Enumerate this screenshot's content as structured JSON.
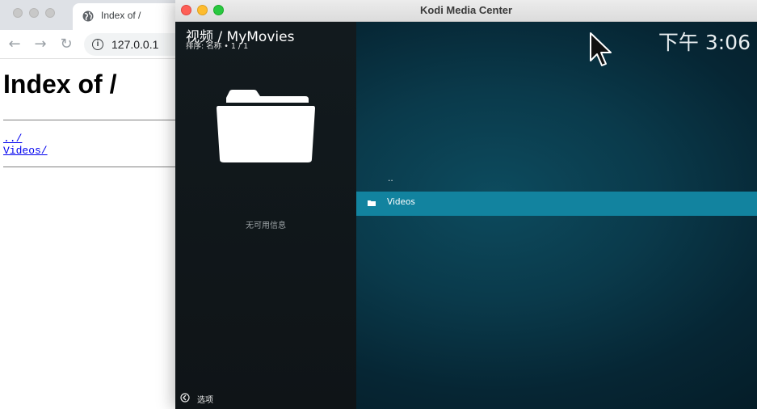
{
  "browser": {
    "tab_title": "Index of /",
    "url": "127.0.0.1",
    "page_heading": "Index of /",
    "links": [
      "../",
      "Videos/"
    ],
    "icons": {
      "back": "back-arrow-icon",
      "forward": "forward-arrow-icon",
      "reload": "reload-icon",
      "site_info": "info-icon",
      "favicon": "globe-icon"
    }
  },
  "kodi": {
    "window_title": "Kodi Media Center",
    "header_title": "视频 / MyMovies",
    "sort_info": "排序: 名称  •  1 / 1",
    "clock": "下午 3:06",
    "no_info": "无可用信息",
    "options_label": "选项",
    "items": [
      {
        "label": "..",
        "selected": false
      },
      {
        "label": "Videos",
        "selected": true
      }
    ],
    "colors": {
      "selected_row": "#12839f",
      "background": "#0a3a4b",
      "sidebar": "#121a1e"
    },
    "icons": {
      "folder_thumbnail": "folder-icon",
      "options": "options-arrow-icon",
      "cursor": "mouse-pointer-icon"
    }
  }
}
